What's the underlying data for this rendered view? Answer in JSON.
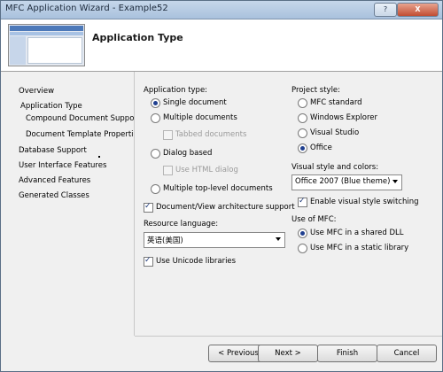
{
  "window": {
    "title": "MFC Application Wizard - Example52",
    "help_label": "?",
    "close_label": "X"
  },
  "header": {
    "title": "Application Type"
  },
  "nav": {
    "items": [
      "Overview",
      "Application Type",
      "Compound Document Support",
      "Document Template Properties",
      "Database Support",
      "User Interface Features",
      "Advanced Features",
      "Generated Classes"
    ]
  },
  "app_type": {
    "label": "Application type:",
    "options": [
      {
        "label": "Single document",
        "selected": true
      },
      {
        "label": "Multiple documents",
        "selected": false
      },
      {
        "label": "Tabbed documents",
        "checked": false,
        "disabled": true
      },
      {
        "label": "Dialog based",
        "selected": false
      },
      {
        "label": "Use HTML dialog",
        "checked": false,
        "disabled": true
      },
      {
        "label": "Multiple top-level documents",
        "selected": false
      }
    ],
    "doc_view": {
      "label": "Document/View architecture support",
      "checked": true
    }
  },
  "resource_language": {
    "label": "Resource language:",
    "value": "英语(美国)"
  },
  "unicode": {
    "label": "Use Unicode libraries",
    "checked": true
  },
  "project_style": {
    "label": "Project style:",
    "options": [
      {
        "label": "MFC standard",
        "selected": false
      },
      {
        "label": "Windows Explorer",
        "selected": false
      },
      {
        "label": "Visual Studio",
        "selected": false
      },
      {
        "label": "Office",
        "selected": true
      }
    ]
  },
  "visual_style": {
    "label": "Visual style and colors:",
    "value": "Office 2007 (Blue theme)",
    "switching": {
      "label": "Enable visual style switching",
      "checked": true
    }
  },
  "use_mfc": {
    "label": "Use of MFC:",
    "options": [
      {
        "label": "Use MFC in a shared DLL",
        "selected": true
      },
      {
        "label": "Use MFC in a static library",
        "selected": false
      }
    ]
  },
  "buttons": {
    "previous": "< Previous",
    "next": "Next >",
    "finish": "Finish",
    "cancel": "Cancel"
  }
}
